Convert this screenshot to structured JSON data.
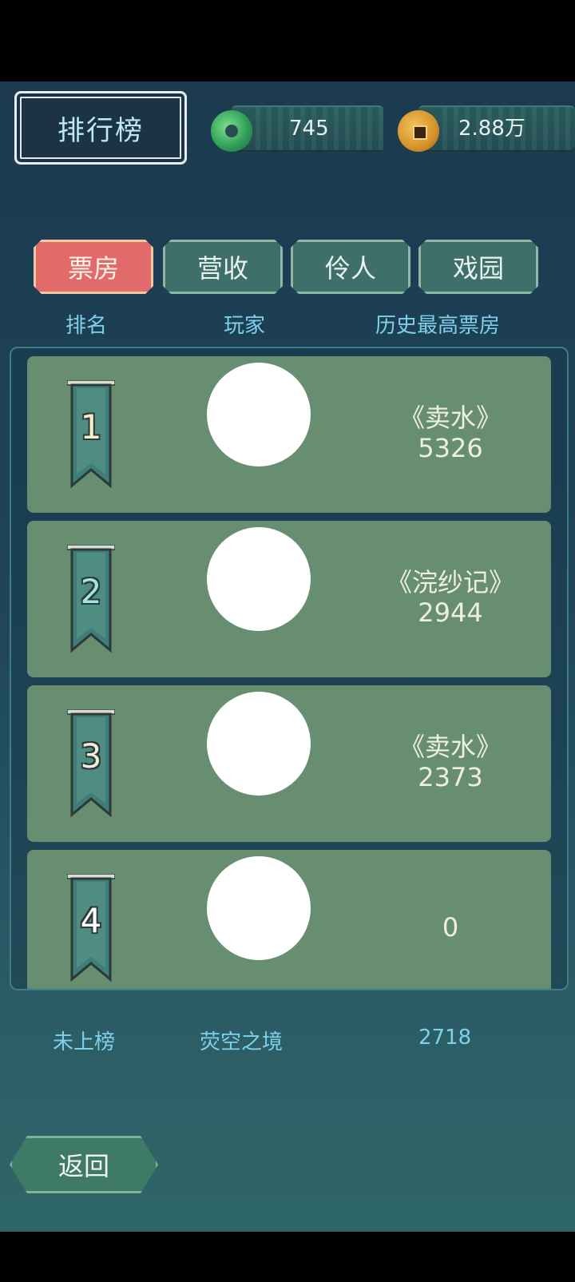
{
  "header": {
    "title": "排行榜"
  },
  "currency": {
    "jade": "745",
    "coins": "2.88万"
  },
  "tabs": [
    {
      "label": "票房",
      "active": true
    },
    {
      "label": "营收",
      "active": false
    },
    {
      "label": "伶人",
      "active": false
    },
    {
      "label": "戏园",
      "active": false
    }
  ],
  "columns": {
    "rank": "排名",
    "player": "玩家",
    "best": "历史最高票房"
  },
  "rows": [
    {
      "rank": "1",
      "play": "《卖水》",
      "value": "5326"
    },
    {
      "rank": "2",
      "play": "《浣纱记》",
      "value": "2944"
    },
    {
      "rank": "3",
      "play": "《卖水》",
      "value": "2373"
    },
    {
      "rank": "4",
      "play": "",
      "value": "0"
    }
  ],
  "own": {
    "rank": "未上榜",
    "name": "荧空之境",
    "value": "2718"
  },
  "footer": {
    "back_label": "返回"
  },
  "colors": {
    "active_tab": "#e26a6a",
    "row_bg": "#688e72",
    "accent_text": "#7fd0ea"
  }
}
